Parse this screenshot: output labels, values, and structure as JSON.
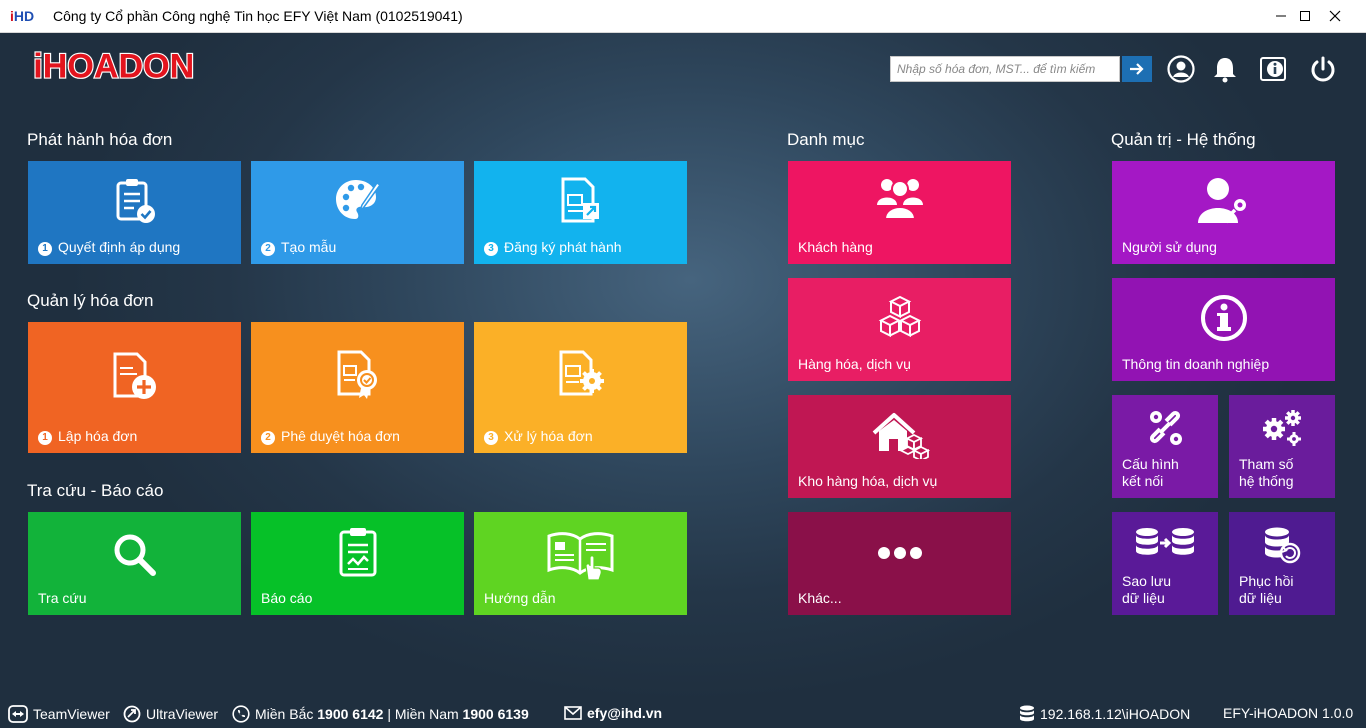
{
  "window": {
    "logo_i": "i",
    "logo_hd": "HD",
    "title": "Công ty Cổ phần Công nghệ Tin học EFY Việt Nam (0102519041)"
  },
  "brand": {
    "logo_text": "iHOADON"
  },
  "search": {
    "placeholder": "Nhập số hóa đơn, MST... để tìm kiếm",
    "value": ""
  },
  "sections": {
    "phat_hanh": "Phát hành hóa đơn",
    "quan_ly": "Quản lý hóa đơn",
    "tra_cuu": "Tra cứu - Báo cáo",
    "danh_muc": "Danh mục",
    "quan_tri": "Quản trị - Hệ thống"
  },
  "tiles": {
    "quyet_dinh": {
      "num": "1",
      "label": "Quyết định áp dụng",
      "color": "#1f76c2"
    },
    "tao_mau": {
      "num": "2",
      "label": "Tạo mẫu",
      "color": "#2f9ae8"
    },
    "dang_ky": {
      "num": "3",
      "label": "Đăng ký phát hành",
      "color": "#12b3ee"
    },
    "lap_hoa_don": {
      "num": "1",
      "label": "Lập hóa đơn",
      "color": "#f06423"
    },
    "phe_duyet": {
      "num": "2",
      "label": "Phê duyệt hóa đơn",
      "color": "#f7901e"
    },
    "xu_ly": {
      "num": "3",
      "label": "Xử lý hóa đơn",
      "color": "#fbb027"
    },
    "tra_cuu": {
      "label": "Tra cứu",
      "color": "#12b33a"
    },
    "bao_cao": {
      "label": "Báo cáo",
      "color": "#06c128"
    },
    "huong_dan": {
      "label": "Hướng dẫn",
      "color": "#5fd422"
    },
    "khach_hang": {
      "label": "Khách hàng",
      "color": "#ee1562"
    },
    "hang_hoa": {
      "label": "Hàng hóa, dịch vụ",
      "color": "#e81e64"
    },
    "kho_hang": {
      "label": "Kho hàng hóa, dịch vụ",
      "color": "#c01753"
    },
    "khac": {
      "label": "Khác...",
      "color": "#8a1049"
    },
    "nguoi_su_dung": {
      "label": "Người sử dụng",
      "color": "#a418c5"
    },
    "thong_tin": {
      "label": "Thông tin doanh nghiệp",
      "color": "#9213b3"
    },
    "cau_hinh": {
      "line1": "Cấu hình",
      "line2": "kết nối",
      "color": "#7a1aa6"
    },
    "tham_so": {
      "line1": "Tham số",
      "line2": "hệ thống",
      "color": "#6a1c9c"
    },
    "sao_luu": {
      "line1": "Sao lưu",
      "line2": "dữ liệu",
      "color": "#5a1a98"
    },
    "phuc_hoi": {
      "line1": "Phục hồi",
      "line2": "dữ liệu",
      "color": "#4f1b91"
    }
  },
  "footer": {
    "teamviewer": "TeamViewer",
    "ultraviewer": "UltraViewer",
    "mien_bac_label": "Miền Bắc",
    "mien_bac_phone": "1900 6142",
    "separator": "|",
    "mien_nam_label": "Miền Nam",
    "mien_nam_phone": "1900 6139",
    "email": "efy@ihd.vn",
    "server": "192.168.1.12\\iHOADON",
    "version": "EFY-iHOADON 1.0.0"
  }
}
